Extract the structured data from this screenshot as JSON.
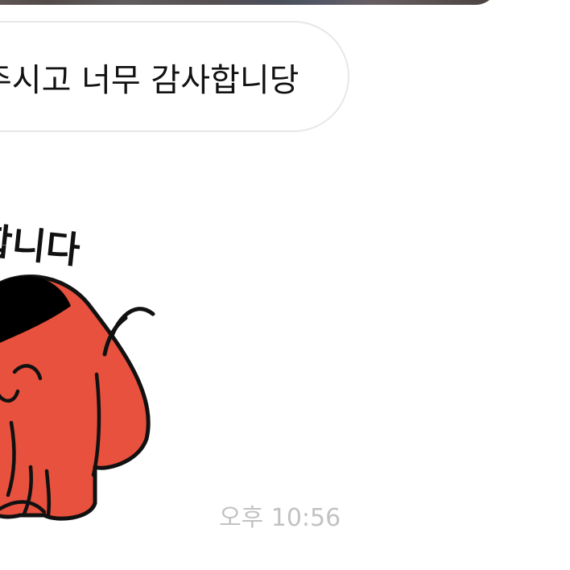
{
  "conversation": {
    "message_text": "주시고 너무 감사합니당",
    "timestamp": "오후 10:56"
  },
  "sticker": {
    "caption": "합니다",
    "icon": "red-character-sticker",
    "colors": {
      "body": "#e8513e",
      "outline": "#111111",
      "hair": "#000000"
    }
  },
  "theme": {
    "background": "#ffffff",
    "bubble_border": "#e7e7e7",
    "text": "#111111",
    "timestamp": "#c2c2c2"
  }
}
